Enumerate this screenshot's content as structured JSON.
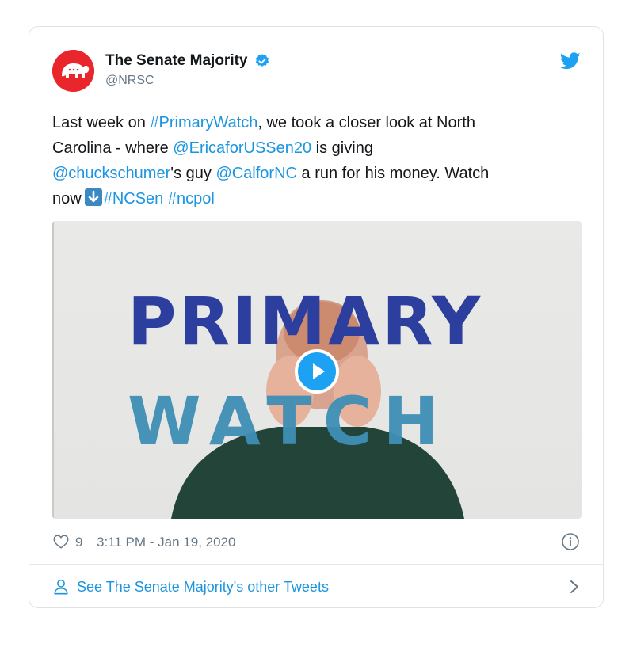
{
  "tweet": {
    "author": {
      "display_name": "The Senate Majority",
      "handle": "@NRSC",
      "verified": true,
      "avatar_icon": "elephant-logo-icon",
      "avatar_color": "#e8262c"
    },
    "text_segments": [
      {
        "text": "Last week on ",
        "link": false
      },
      {
        "text": "#PrimaryWatch",
        "link": true
      },
      {
        "text": ", we took a closer look at North\nCarolina - where ",
        "link": false
      },
      {
        "text": "@EricaforUSSen20",
        "link": true
      },
      {
        "text": " is giving\n",
        "link": false
      },
      {
        "text": "@chuckschumer",
        "link": true
      },
      {
        "text": "'s guy ",
        "link": false
      },
      {
        "text": "@CalforNC",
        "link": true
      },
      {
        "text": " a run for his money. Watch\nnow",
        "link": false
      }
    ],
    "text_emoji": "arrow-down-emoji",
    "text_tail_segments": [
      {
        "text": "#NCSen",
        "link": true
      },
      {
        "text": " ",
        "link": false
      },
      {
        "text": "#ncpol",
        "link": true
      }
    ],
    "media": {
      "title_line_1": "PRIMARY",
      "title_line_2": "WATCH",
      "title_color_1": "#2c3e9e",
      "title_color_2": "#3f8fb6",
      "play_icon": "play-icon"
    },
    "likes": "9",
    "timestamp": "3:11 PM - Jan 19, 2020",
    "footer_label": "See The Senate Majority's other Tweets"
  },
  "colors": {
    "link": "#1b95e0",
    "muted": "#657786",
    "twitter_blue": "#1da1f2"
  }
}
